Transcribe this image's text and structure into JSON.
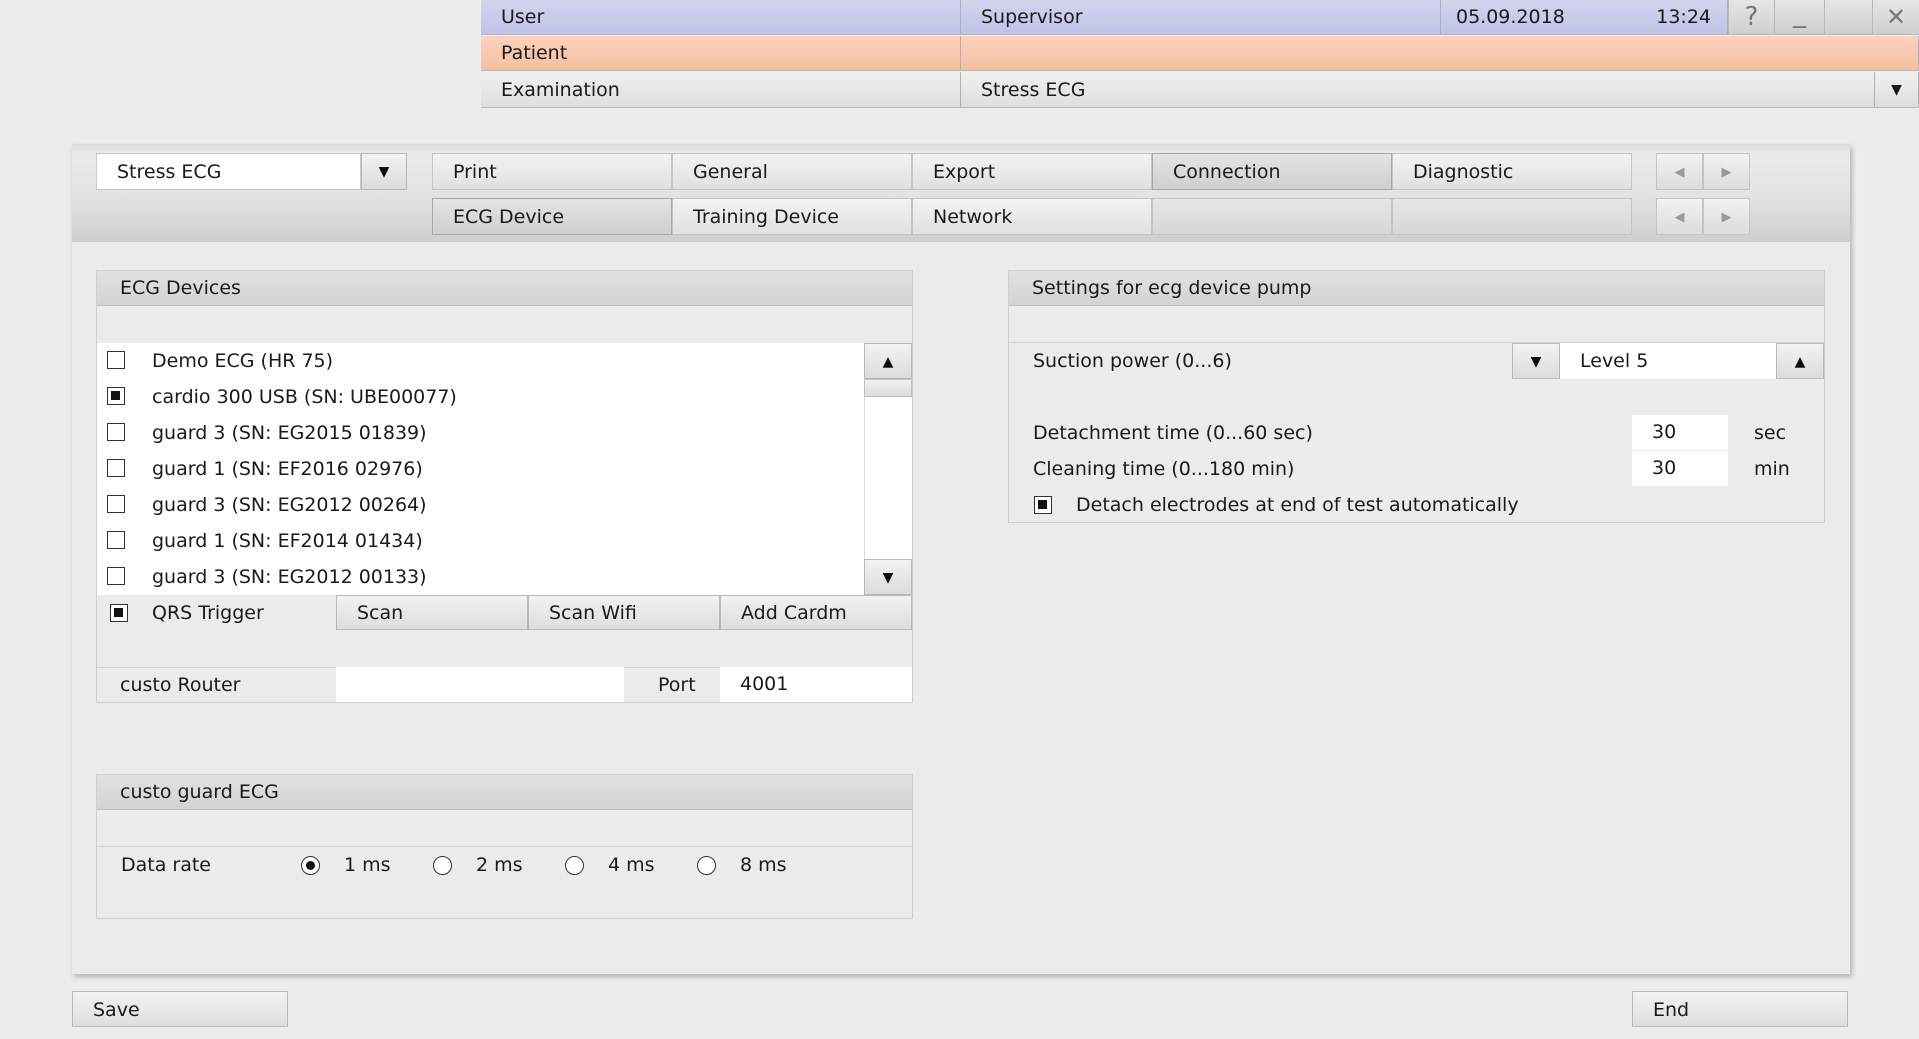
{
  "header": {
    "user_label": "User",
    "user_value": "Supervisor",
    "date": "05.09.2018",
    "time": "13:24",
    "patient_label": "Patient",
    "patient_value": "",
    "exam_label": "Examination",
    "exam_value": "Stress ECG",
    "help_glyph": "?",
    "minimize_glyph": "_",
    "close_glyph": "✕"
  },
  "config_selector": {
    "value": "Stress ECG"
  },
  "tabs_top": [
    "Print",
    "General",
    "Export",
    "Connection",
    "Diagnostic"
  ],
  "tabs_bottom": [
    "ECG Device",
    "Training Device",
    "Network",
    "",
    ""
  ],
  "active_tabs": {
    "top": "Connection",
    "bottom": "ECG Device"
  },
  "ecg_devices": {
    "title": "ECG Devices",
    "devices": [
      {
        "label": "Demo ECG (HR 75)",
        "checked": false
      },
      {
        "label": "cardio 300 USB (SN: UBE00077)",
        "checked": true
      },
      {
        "label": "guard 3 (SN: EG2015 01839)",
        "checked": false
      },
      {
        "label": "guard 1 (SN: EF2016 02976)",
        "checked": false
      },
      {
        "label": "guard 3 (SN: EG2012 00264)",
        "checked": false
      },
      {
        "label": "guard 1 (SN: EF2014 01434)",
        "checked": false
      },
      {
        "label": "guard 3 (SN: EG2012 00133)",
        "checked": false
      }
    ],
    "qrs_trigger_label": "QRS Trigger",
    "qrs_trigger_checked": true,
    "scan_label": "Scan",
    "scan_wifi_label": "Scan Wifi",
    "add_cardm_label": "Add Cardm",
    "router_label": "custo Router",
    "router_value": "",
    "port_label": "Port",
    "port_value": "4001"
  },
  "guard_ecg": {
    "title": "custo guard ECG",
    "data_rate_label": "Data rate",
    "rates": [
      "1 ms",
      "2 ms",
      "4 ms",
      "8 ms"
    ],
    "selected_rate": "1 ms"
  },
  "pump": {
    "title": "Settings for ecg device pump",
    "suction_label": "Suction power (0...6)",
    "suction_value": "Level 5",
    "detachment_label": "Detachment time (0...60 sec)",
    "detachment_value": "30",
    "detachment_unit": "sec",
    "cleaning_label": "Cleaning time (0...180 min)",
    "cleaning_value": "30",
    "cleaning_unit": "min",
    "auto_detach_label": "Detach electrodes at end of test automatically",
    "auto_detach_checked": true
  },
  "footer": {
    "save_label": "Save",
    "end_label": "End"
  }
}
